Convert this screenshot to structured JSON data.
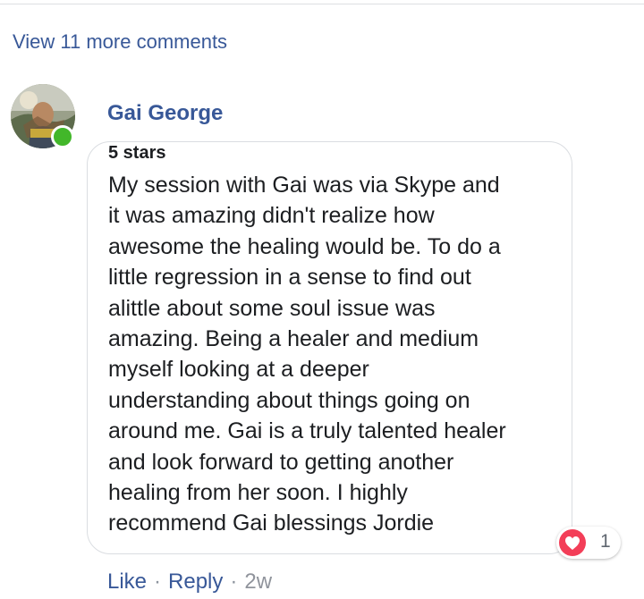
{
  "comments": {
    "view_more_label": "View 11 more comments"
  },
  "comment": {
    "author": "Gai George",
    "rating_label": "5 stars",
    "body": "My session with Gai was via Skype and\nit was amazing didn't realize how\nawesome the healing would be. To do a\nlittle regression in a sense to find out\nalittle about some soul issue was\namazing. Being a healer and medium\nmyself looking at a deeper\nunderstanding about things going on\naround me. Gai is a truly talented healer\nand look forward to getting another\nhealing from her soon. I highly\nrecommend Gai blessings Jordie",
    "reaction": {
      "icon": "love-icon",
      "count": "1",
      "color": "#f33e58"
    },
    "actions": {
      "like_label": "Like",
      "separator": "·",
      "reply_label": "Reply",
      "timestamp": "2w"
    },
    "presence": {
      "status": "online",
      "color": "#42b72a"
    }
  },
  "colors": {
    "link": "#385898",
    "text": "#1c1e21",
    "muted": "#90949c"
  }
}
